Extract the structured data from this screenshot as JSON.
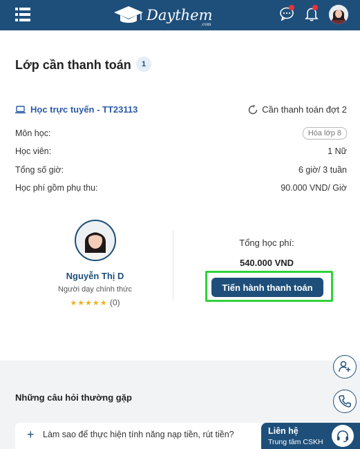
{
  "header": {
    "logo_text": "Daythem",
    "logo_sub": ".com",
    "icons": [
      "menu-icon",
      "chat-icon",
      "bell-icon",
      "avatar"
    ],
    "brand_color": "#1e4f7a"
  },
  "main": {
    "title": "Lớp cần thanh toán",
    "count": "1",
    "class_item": {
      "name": "Học trực tuyến - TT23113",
      "status": "Cần thanh toán đợt 2",
      "rows": [
        {
          "label": "Môn học:",
          "value": "Hóa lớp 8"
        },
        {
          "label": "Học viên:",
          "value": "1 Nữ"
        },
        {
          "label": "Tổng số giờ:",
          "value": "6 giờ/ 3 tuần"
        },
        {
          "label": "Học phí gồm phụ thu:",
          "value": "90.000 VND/ Giờ"
        }
      ]
    },
    "teacher": {
      "name": "Nguyễn Thị D",
      "role": "Người dạy chính thức",
      "stars": "★★★★★",
      "rating_count": "(0)"
    },
    "fee": {
      "label": "Tổng học phí:",
      "value": "540.000 VND",
      "pay_button": "Tiến hành thanh toán"
    }
  },
  "faq": {
    "title": "Những câu hỏi thường gặp",
    "items": [
      {
        "plus": "+",
        "text": "Làm sao để thực hiện tính năng nạp tiền, rút tiền?"
      }
    ]
  },
  "contact": {
    "title": "Liên hệ",
    "subtitle": "Trung tâm CSKH"
  },
  "colors": {
    "highlight": "#2fd23a",
    "notification_dot": "#e8333b",
    "star": "#f2b01e"
  }
}
